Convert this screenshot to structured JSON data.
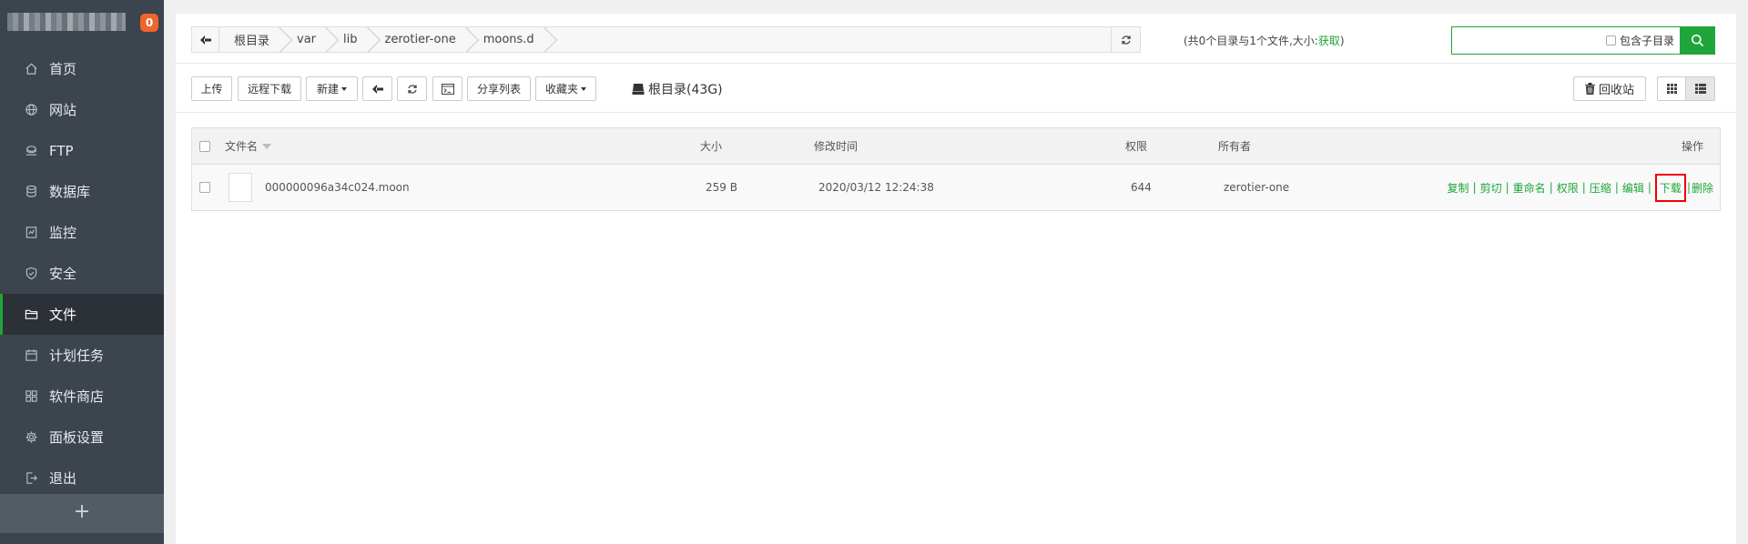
{
  "sidebar": {
    "badge": "0",
    "items": [
      {
        "label": "首页",
        "icon": "home-icon"
      },
      {
        "label": "网站",
        "icon": "globe-icon"
      },
      {
        "label": "FTP",
        "icon": "ftp-icon"
      },
      {
        "label": "数据库",
        "icon": "database-icon"
      },
      {
        "label": "监控",
        "icon": "monitor-icon"
      },
      {
        "label": "安全",
        "icon": "shield-icon"
      },
      {
        "label": "文件",
        "icon": "folder-icon",
        "active": true
      },
      {
        "label": "计划任务",
        "icon": "calendar-icon"
      },
      {
        "label": "软件商店",
        "icon": "apps-icon"
      },
      {
        "label": "面板设置",
        "icon": "gear-icon"
      },
      {
        "label": "退出",
        "icon": "logout-icon"
      }
    ],
    "add_label": "+"
  },
  "breadcrumb": [
    "根目录",
    "var",
    "lib",
    "zerotier-one",
    "moons.d"
  ],
  "summary": {
    "prefix": "(共0个目录与1个文件,大小:",
    "link": "获取",
    "suffix": ")"
  },
  "search": {
    "value": "",
    "placeholder": "",
    "subdir_label": "包含子目录"
  },
  "toolbar": {
    "upload": "上传",
    "remote_download": "远程下载",
    "new": "新建",
    "share_list": "分享列表",
    "favorites": "收藏夹",
    "disk_label": "根目录(43G)",
    "recycle_bin": "回收站"
  },
  "table": {
    "headers": {
      "name": "文件名",
      "size": "大小",
      "mtime": "修改时间",
      "perm": "权限",
      "owner": "所有者",
      "ops": "操作"
    },
    "rows": [
      {
        "name": "000000096a34c024.moon",
        "size": "259 B",
        "mtime": "2020/03/12 12:24:38",
        "perm": "644",
        "owner": "zerotier-one"
      }
    ],
    "ops": [
      "复制",
      "剪切",
      "重命名",
      "权限",
      "压缩",
      "编辑",
      "下载",
      "删除"
    ]
  },
  "colors": {
    "accent": "#20a53a",
    "sidebar_bg": "#3c444d",
    "badge": "#f0642d",
    "highlight": "#e00000"
  }
}
